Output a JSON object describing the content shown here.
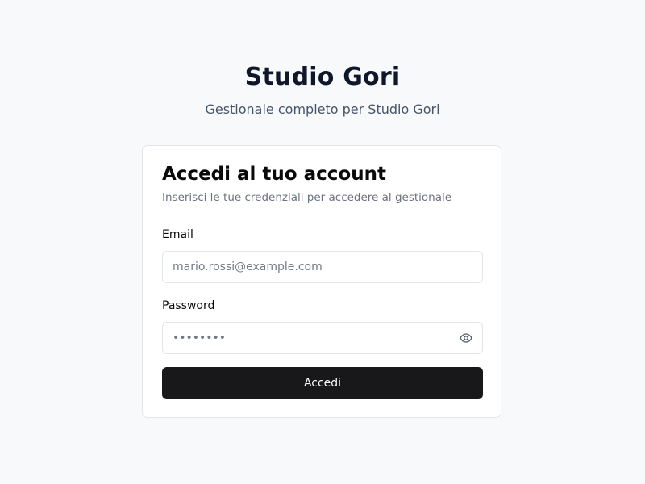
{
  "header": {
    "title": "Studio Gori",
    "subtitle": "Gestionale completo per Studio Gori"
  },
  "login_card": {
    "title": "Accedi al tuo account",
    "description": "Inserisci le tue credenziali per accedere al gestionale",
    "email": {
      "label": "Email",
      "placeholder": "mario.rossi@example.com",
      "value": ""
    },
    "password": {
      "label": "Password",
      "placeholder": "••••••••",
      "value": ""
    },
    "toggle_icon": "eye-icon",
    "submit_label": "Accedi"
  }
}
